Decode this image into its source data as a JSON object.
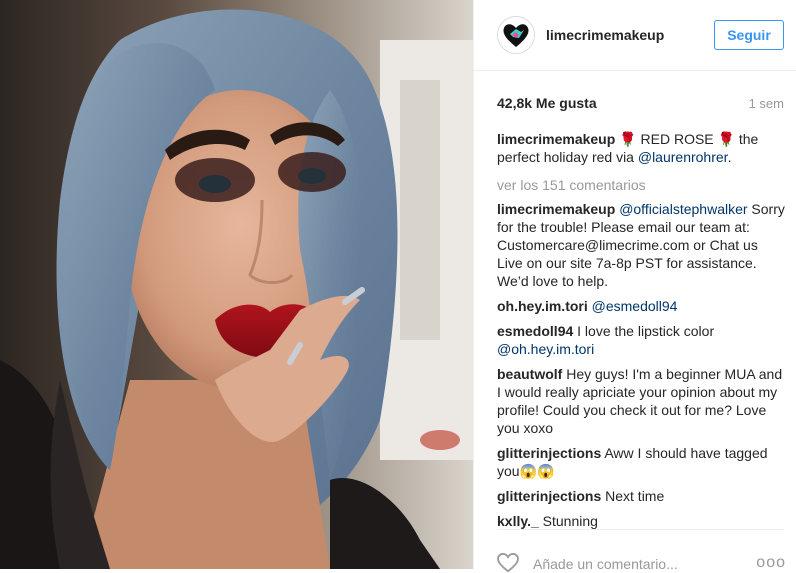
{
  "post": {
    "username": "limecrimemakeup",
    "follow_label": "Seguir",
    "likes": "42,8k Me gusta",
    "time": "1 sem",
    "caption_user": "limecrimemakeup",
    "caption_text_1": " 🌹 RED ROSE 🌹 the perfect holiday red via ",
    "caption_mention": "@laurenrohrer",
    "caption_text_2": ".",
    "view_comments": "ver los 151 comentarios"
  },
  "comments": [
    {
      "user": "limecrimemakeup",
      "mention": "@officialstephwalker",
      "text": " Sorry for the trouble! Please email our team at: Customercare@limecrime.com or Chat us Live on our site 7a-8p PST for assistance. We’d love to help."
    },
    {
      "user": "oh.hey.im.tori",
      "mention": "@esmedoll94",
      "text": ""
    },
    {
      "user": "esmedoll94",
      "text": " I love the lipstick color ",
      "mention": "@oh.hey.im.tori"
    },
    {
      "user": "beautwolf",
      "text": " Hey guys! I'm a beginner MUA and I would really apriciate your opinion about my profile! Could you check it out for me? Love you xoxo"
    },
    {
      "user": "glitterinjections",
      "text": " Aww I should have tagged you😱😱"
    },
    {
      "user": "glitterinjections",
      "text": " Next time"
    },
    {
      "user": "kxlly._",
      "text": " Stunning"
    }
  ],
  "footer": {
    "add_comment_placeholder": "Añade un comentario...",
    "more_icon": "ooo"
  },
  "colors": {
    "accent": "#3897f0",
    "mention": "#003569",
    "muted": "#999999"
  }
}
